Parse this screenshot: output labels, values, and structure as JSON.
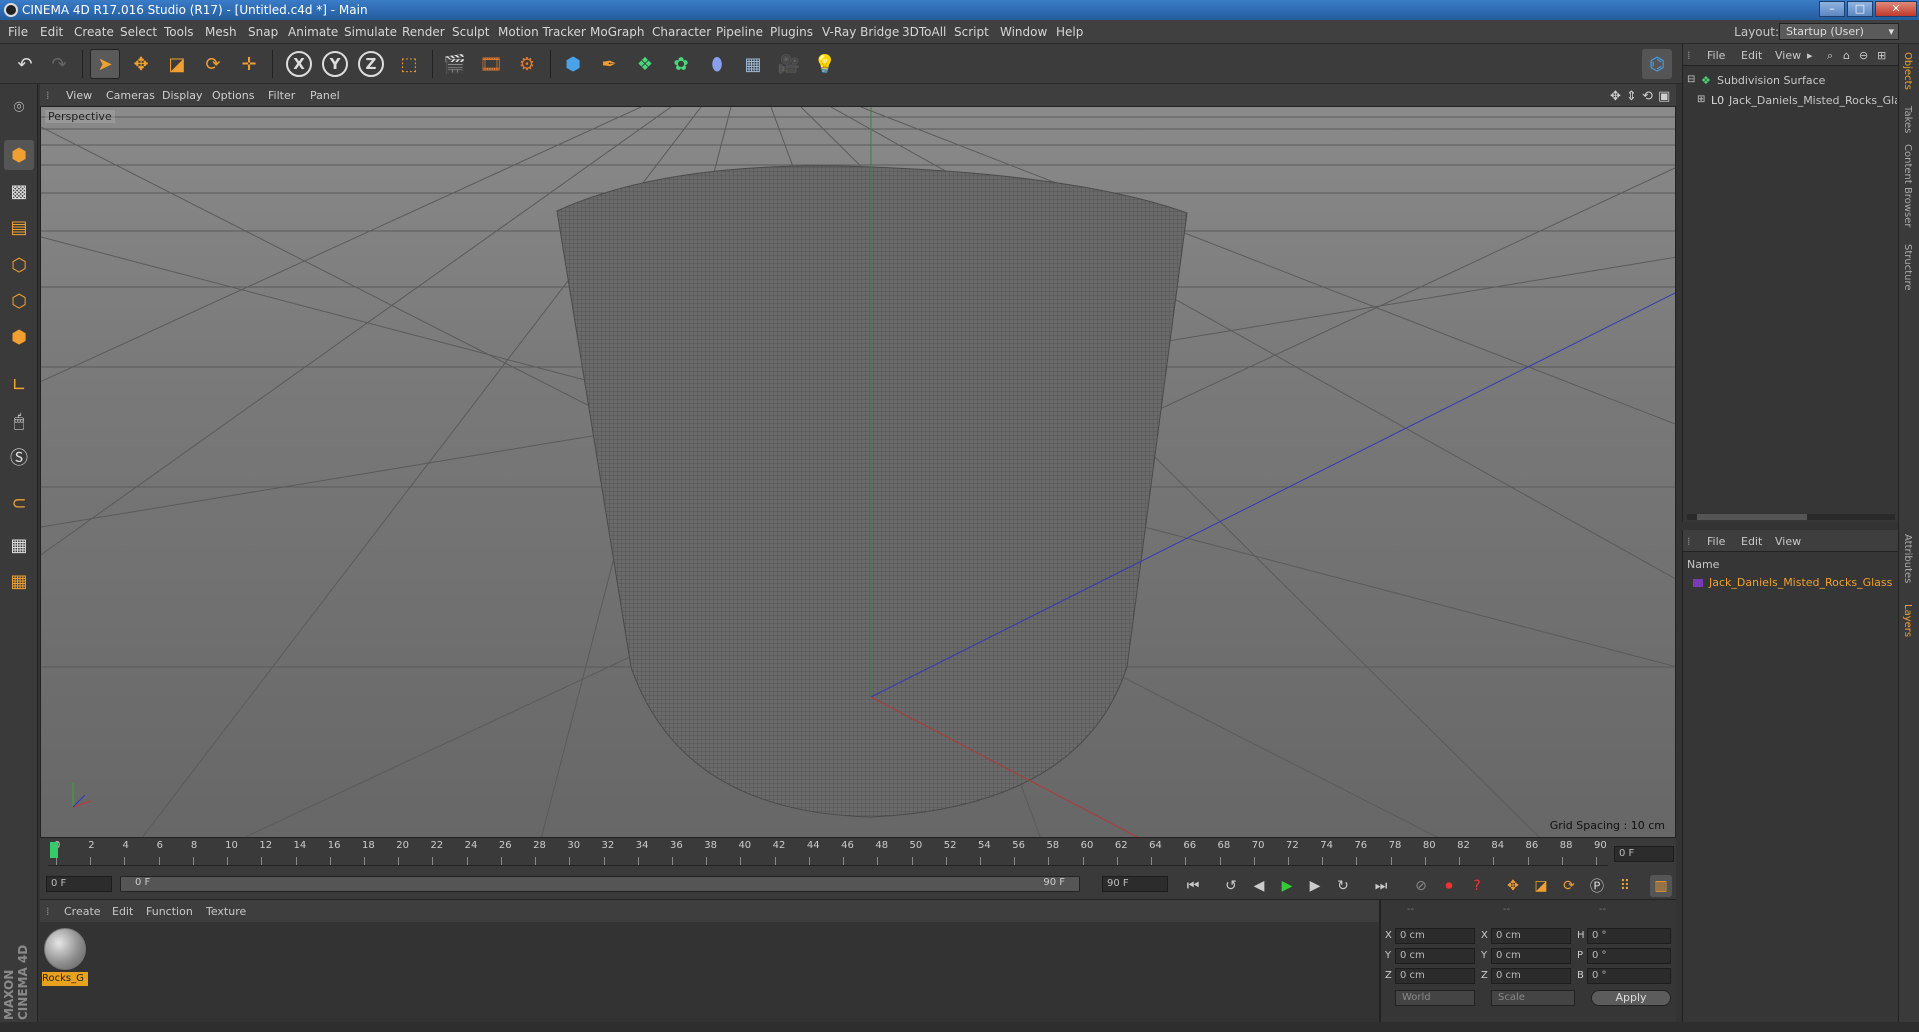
{
  "window": {
    "title": "CINEMA 4D R17.016 Studio (R17) - [Untitled.c4d *] - Main",
    "min": "–",
    "max": "□",
    "close": "✕"
  },
  "menu": [
    "File",
    "Edit",
    "Create",
    "Select",
    "Tools",
    "Mesh",
    "Snap",
    "Animate",
    "Simulate",
    "Render",
    "Sculpt",
    "Motion Tracker",
    "MoGraph",
    "Character",
    "Pipeline",
    "Plugins",
    "V-Ray Bridge",
    "3DToAll",
    "Script",
    "Window",
    "Help"
  ],
  "layout": {
    "label": "Layout:",
    "value": "Startup (User)"
  },
  "toolbar": {
    "axis_x": "X",
    "axis_y": "Y",
    "axis_z": "Z"
  },
  "viewport_menu": [
    "View",
    "Cameras",
    "Display",
    "Options",
    "Filter",
    "Panel"
  ],
  "viewport": {
    "label": "Perspective",
    "grid_spacing": "Grid Spacing : 10 cm"
  },
  "timeline": {
    "ticks": [
      "0",
      "2",
      "4",
      "6",
      "8",
      "10",
      "12",
      "14",
      "16",
      "18",
      "20",
      "22",
      "24",
      "26",
      "28",
      "30",
      "32",
      "34",
      "36",
      "38",
      "40",
      "42",
      "44",
      "46",
      "48",
      "50",
      "52",
      "54",
      "56",
      "58",
      "60",
      "62",
      "64",
      "66",
      "68",
      "70",
      "72",
      "74",
      "76",
      "78",
      "80",
      "82",
      "84",
      "86",
      "88",
      "90"
    ],
    "current_frame": "0 F",
    "start": "0 F",
    "range_start": "0 F",
    "range_end": "90 F",
    "end": "90 F"
  },
  "materials": {
    "menu": [
      "Create",
      "Edit",
      "Function",
      "Texture"
    ],
    "item_label": "Rocks_G"
  },
  "coords": {
    "headers": [
      "--",
      "--",
      "--"
    ],
    "rows": [
      {
        "a": "X",
        "av": "0 cm",
        "b": "X",
        "bv": "0 cm",
        "c": "H",
        "cv": "0 °"
      },
      {
        "a": "Y",
        "av": "0 cm",
        "b": "Y",
        "bv": "0 cm",
        "c": "P",
        "cv": "0 °"
      },
      {
        "a": "Z",
        "av": "0 cm",
        "b": "Z",
        "bv": "0 cm",
        "c": "B",
        "cv": "0 °"
      }
    ],
    "world": "World",
    "scale": "Scale",
    "apply": "Apply"
  },
  "objects": {
    "menu": [
      "File",
      "Edit",
      "View"
    ],
    "items": [
      "Subdivision Surface",
      "Jack_Daniels_Misted_Rocks_Glas"
    ]
  },
  "layers": {
    "menu": [
      "File",
      "Edit",
      "View"
    ],
    "header": "Name",
    "item": "Jack_Daniels_Misted_Rocks_Glass"
  },
  "right_tabs": [
    "Objects",
    "Takes",
    "Content Browser",
    "Structure",
    "Attributes",
    "Layers"
  ],
  "brand": "MAXON CINEMA 4D"
}
